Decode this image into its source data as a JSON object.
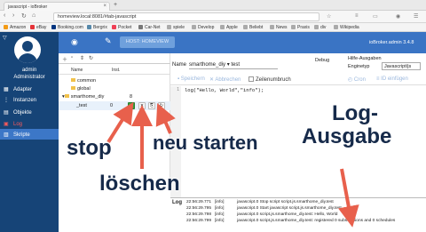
{
  "browser": {
    "tab_title": "javascript - ioBroker",
    "new_tab": "+",
    "url": "homeview.local:8081/#tab-javascript",
    "bookmarks": [
      {
        "label": "Amazon",
        "color": "#f39b16"
      },
      {
        "label": "eBay",
        "color": "#e53238"
      },
      {
        "label": "Booking.com",
        "color": "#003580"
      },
      {
        "label": "Bergrix",
        "color": "#58a"
      },
      {
        "label": "Pocket",
        "color": "#ef4056"
      },
      {
        "label": "Car-Net",
        "color": "#777"
      },
      {
        "label": "spiele",
        "color": "#aaa"
      },
      {
        "label": "Develop",
        "color": "#aaa"
      },
      {
        "label": "Apple",
        "color": "#aaa"
      },
      {
        "label": "Beliebt",
        "color": "#aaa"
      },
      {
        "label": "News",
        "color": "#aaa"
      },
      {
        "label": "Praxis",
        "color": "#aaa"
      },
      {
        "label": "div",
        "color": "#aaa"
      },
      {
        "label": "Wikipedia",
        "color": "#aaa"
      }
    ]
  },
  "sidebar": {
    "user_name": "admin",
    "user_role": "Administrator",
    "items": [
      {
        "label": "Adapter",
        "icon": "grid-icon"
      },
      {
        "label": "Instanzen",
        "icon": "instances-icon"
      },
      {
        "label": "Objekte",
        "icon": "objects-icon"
      },
      {
        "label": "Log",
        "icon": "log-icon"
      },
      {
        "label": "Skripte",
        "icon": "scripts-icon"
      }
    ]
  },
  "topbar": {
    "host_button": "HOST: HOMEVIEW",
    "version": "ioBroker.admin 3.4.8"
  },
  "tree": {
    "col_name": "Name",
    "col_instance": "Inst.",
    "rows": [
      {
        "label": "common",
        "inst": "",
        "type": "folder"
      },
      {
        "label": "global",
        "inst": "",
        "type": "folder"
      },
      {
        "label": "smarthome_diy",
        "inst": "8",
        "type": "folder"
      },
      {
        "label": "_test",
        "inst": "0",
        "type": "script"
      }
    ]
  },
  "editor": {
    "name_label": "Name",
    "name_value": "smarthome_diy",
    "name_suffix": "test",
    "debug_label": "Debug",
    "help_label": "Hilfe-Ausgaben",
    "engine_label": "Enginetyp",
    "engine_value": "Javascript/js",
    "save_label": "Speichern",
    "cancel_label": "Abbrechen",
    "wrap_label": "Zeilenumbruch",
    "cron_label": "Cron",
    "insert_id_label": "ID einfügen",
    "code_line": "log(\"Hello, World\",\"info\");",
    "line_no": "1"
  },
  "log": {
    "title": "Log",
    "entries": [
      {
        "time": "22:56:29.771",
        "level": "[info]",
        "message": "javascript.0 Stop script script.js.smarthome_diy.test"
      },
      {
        "time": "22:56:29.795",
        "level": "[info]",
        "message": "javascript.0 Start javascript script.js.smarthome_diy.test"
      },
      {
        "time": "22:56:29.798",
        "level": "[info]",
        "message": "javascript.0 script.js.smarthome_diy.test: Hello, World"
      },
      {
        "time": "22:56:29.799",
        "level": "[info]",
        "message": "javascript.0 script.js.smarthome_diy.test: registered 0 subscriptions and 0 schedules"
      }
    ]
  },
  "annotations": {
    "stop": "stop",
    "delete": "löschen",
    "restart": "neu starten",
    "log_line1": "Log-",
    "log_line2": "Ausgabe"
  },
  "colors": {
    "sidebar": "#164477",
    "topbar": "#3a74c4",
    "annotation_arrow": "#e8604c",
    "annotation_text": "#162a4a"
  }
}
